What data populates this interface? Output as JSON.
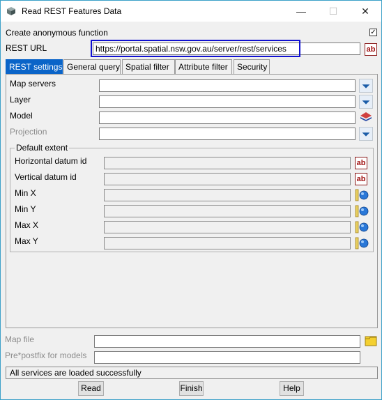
{
  "window": {
    "title": "Read REST Features Data",
    "minimize": "—",
    "maximize": "☐",
    "close": "✕"
  },
  "top": {
    "anon_label": "Create anonymous function",
    "anon_checked": "✓",
    "rest_url_label": "REST URL",
    "rest_url_value": "https://portal.spatial.nsw.gov.au/server/rest/services",
    "ab": "ab"
  },
  "tabs": [
    {
      "label": "REST settings"
    },
    {
      "label": "General query"
    },
    {
      "label": "Spatial filter"
    },
    {
      "label": "Attribute filter"
    },
    {
      "label": "Security"
    }
  ],
  "rest_settings": {
    "map_servers": "Map servers",
    "layer": "Layer",
    "model": "Model",
    "projection": "Projection",
    "default_extent": "Default extent",
    "horizontal_datum": "Horizontal datum id",
    "vertical_datum": "Vertical datum id",
    "min_x": "Min X",
    "min_y": "Min Y",
    "max_x": "Max X",
    "max_y": "Max Y"
  },
  "bottom": {
    "map_file": "Map file",
    "postfix": "Pre*postfix for models",
    "status": "All services are loaded successfully",
    "read": "Read",
    "finish": "Finish",
    "help": "Help"
  },
  "colors": {
    "tab_active": "#0a64c8",
    "highlight_box": "#1010d0",
    "ab_icon": "#a01010"
  }
}
